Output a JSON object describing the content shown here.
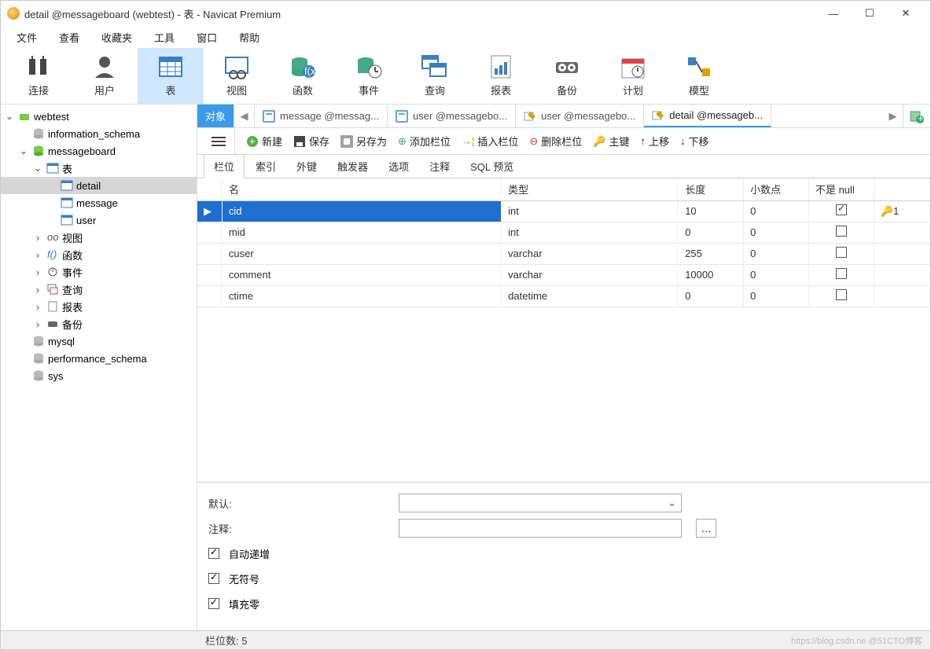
{
  "window": {
    "title": "detail @messageboard (webtest) - 表 - Navicat Premium"
  },
  "menubar": [
    "文件",
    "查看",
    "收藏夹",
    "工具",
    "窗口",
    "帮助"
  ],
  "toolbar": [
    {
      "id": "connect",
      "label": "连接"
    },
    {
      "id": "user",
      "label": "用户"
    },
    {
      "id": "table",
      "label": "表",
      "active": true
    },
    {
      "id": "view",
      "label": "视图"
    },
    {
      "id": "function",
      "label": "函数"
    },
    {
      "id": "event",
      "label": "事件"
    },
    {
      "id": "query",
      "label": "查询"
    },
    {
      "id": "report",
      "label": "报表"
    },
    {
      "id": "backup",
      "label": "备份"
    },
    {
      "id": "plan",
      "label": "计划"
    },
    {
      "id": "model",
      "label": "模型"
    }
  ],
  "tree": {
    "root": "webtest",
    "dbs": [
      {
        "name": "information_schema"
      },
      {
        "name": "messageboard",
        "open": true,
        "children": {
          "tablesLabel": "表",
          "tables": [
            "detail",
            "message",
            "user"
          ],
          "others": [
            {
              "label": "视图",
              "ico": "view"
            },
            {
              "label": "函数",
              "ico": "fn"
            },
            {
              "label": "事件",
              "ico": "event"
            },
            {
              "label": "查询",
              "ico": "query"
            },
            {
              "label": "报表",
              "ico": "report"
            },
            {
              "label": "备份",
              "ico": "backup"
            }
          ]
        }
      },
      {
        "name": "mysql"
      },
      {
        "name": "performance_schema"
      },
      {
        "name": "sys"
      }
    ],
    "selected": "detail"
  },
  "tabs": {
    "object": "对象",
    "items": [
      {
        "label": "message @messag..."
      },
      {
        "label": "user @messagebo..."
      },
      {
        "label": "user @messagebo...",
        "edit": true
      },
      {
        "label": "detail @messageb...",
        "edit": true,
        "active": true
      }
    ]
  },
  "actions": {
    "new": "新建",
    "save": "保存",
    "saveas": "另存为",
    "addfield": "添加栏位",
    "insertfield": "插入栏位",
    "deletefield": "删除栏位",
    "primary": "主键",
    "moveup": "上移",
    "movedown": "下移"
  },
  "subtabs": [
    "栏位",
    "索引",
    "外键",
    "触发器",
    "选项",
    "注释",
    "SQL 预览"
  ],
  "grid": {
    "headers": {
      "name": "名",
      "type": "类型",
      "length": "长度",
      "decimals": "小数点",
      "notnull": "不是 null",
      "key": ""
    },
    "rows": [
      {
        "name": "cid",
        "type": "int",
        "length": "10",
        "decimals": "0",
        "notnull": true,
        "key": "1",
        "selected": true
      },
      {
        "name": "mid",
        "type": "int",
        "length": "0",
        "decimals": "0",
        "notnull": false
      },
      {
        "name": "cuser",
        "type": "varchar",
        "length": "255",
        "decimals": "0",
        "notnull": false
      },
      {
        "name": "comment",
        "type": "varchar",
        "length": "10000",
        "decimals": "0",
        "notnull": false
      },
      {
        "name": "ctime",
        "type": "datetime",
        "length": "0",
        "decimals": "0",
        "notnull": false
      }
    ]
  },
  "props": {
    "defaultLabel": "默认:",
    "commentLabel": "注释:",
    "autoinc": "自动递增",
    "unsigned": "无符号",
    "zerofill": "填充零"
  },
  "status": {
    "left": "栏位数: 5",
    "right": "https://blog.csdn.ne @51CTO博客"
  }
}
